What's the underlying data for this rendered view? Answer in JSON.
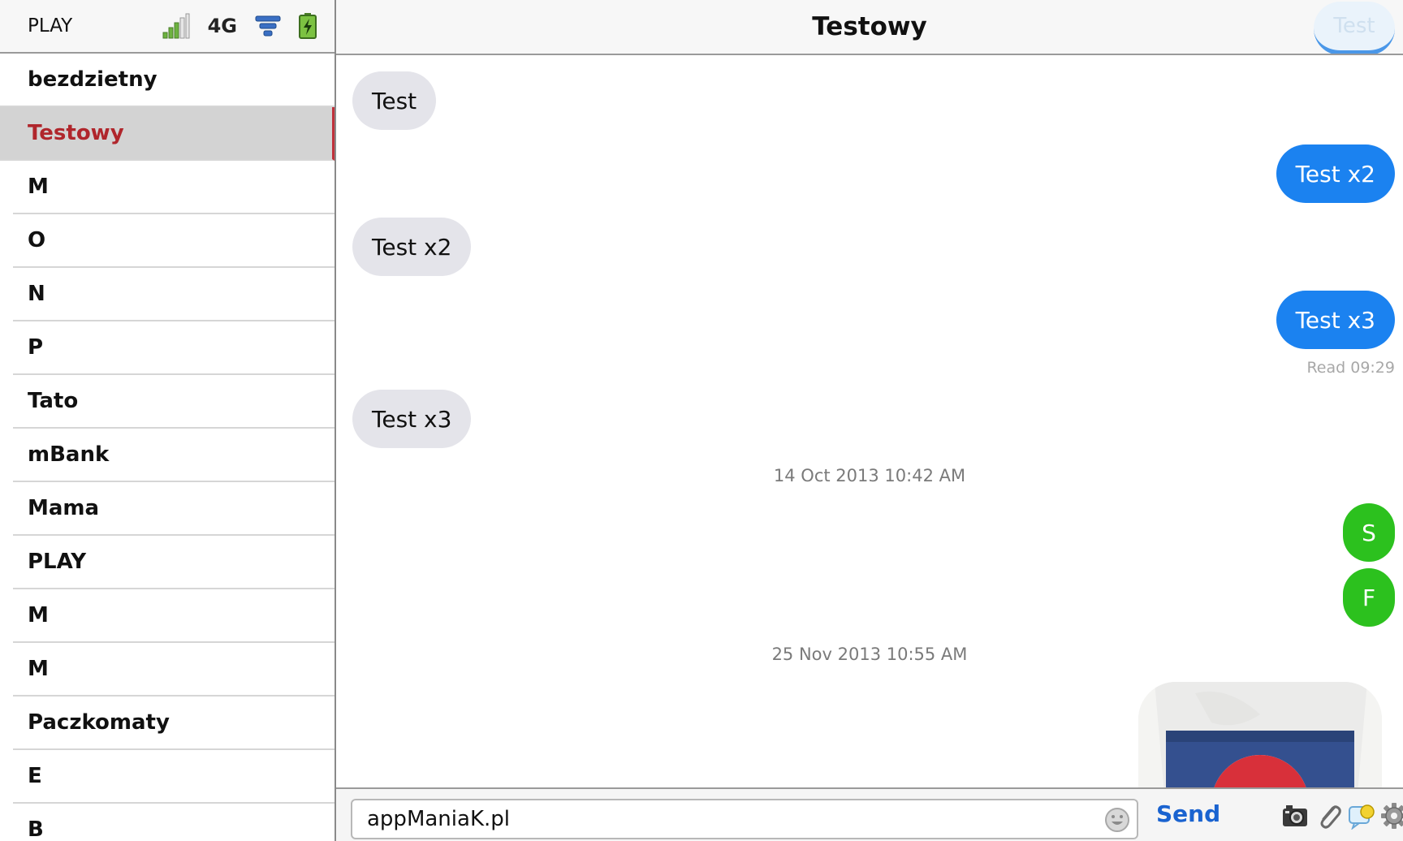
{
  "status": {
    "carrier": "PLAY",
    "network": "4G"
  },
  "contacts": [
    {
      "name": "bezdzietny"
    },
    {
      "name": "Testowy",
      "selected": true
    },
    {
      "name": "M"
    },
    {
      "name": "O"
    },
    {
      "name": "N"
    },
    {
      "name": "P"
    },
    {
      "name": "Tato"
    },
    {
      "name": "mBank"
    },
    {
      "name": "Mama"
    },
    {
      "name": "PLAY"
    },
    {
      "name": "M"
    },
    {
      "name": "M"
    },
    {
      "name": "Paczkomaty"
    },
    {
      "name": "E"
    },
    {
      "name": "B"
    }
  ],
  "chat": {
    "title": "Testowy",
    "ghost_bubble": "Test",
    "messages": [
      {
        "dir": "in",
        "text": "Test"
      },
      {
        "dir": "out",
        "text": "Test x2"
      },
      {
        "dir": "in",
        "text": "Test x2"
      },
      {
        "dir": "out",
        "text": "Test x3"
      },
      {
        "dir": "in",
        "text": "Test x3"
      }
    ],
    "read_receipt": "Read 09:29",
    "date_1": "14 Oct 2013 10:42 AM",
    "circle_1": "S",
    "circle_2": "F",
    "date_2": "25 Nov 2013 10:55 AM"
  },
  "composer": {
    "input_value": "appManiaK.pl",
    "send_label": "Send"
  },
  "colors": {
    "selected_text": "#b0262c",
    "outgoing_bubble": "#1b82f0",
    "incoming_bubble": "#e4e4ea",
    "circle_bubble": "#2cc11e",
    "send_link": "#1a63d0"
  }
}
